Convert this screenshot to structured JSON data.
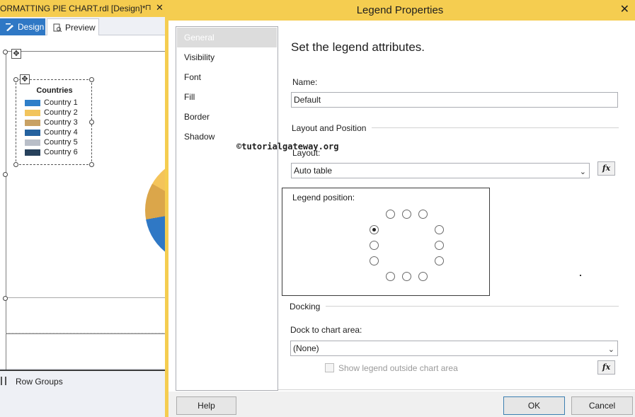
{
  "designer": {
    "doc_tab_title": "ORMATTING PIE CHART.rdl [Design]*",
    "doc_tab_pin": "⊓",
    "doc_tab_close": "✕",
    "tabs": [
      {
        "label": "Design"
      },
      {
        "label": "Preview"
      }
    ],
    "legend": {
      "title": "Countries",
      "items": [
        {
          "label": "Country 1",
          "color": "#2f7fc9"
        },
        {
          "label": "Country 2",
          "color": "#f2c45c"
        },
        {
          "label": "Country 3",
          "color": "#c8a164"
        },
        {
          "label": "Country 4",
          "color": "#25629f"
        },
        {
          "label": "Country 5",
          "color": "#b9bec8"
        },
        {
          "label": "Country 6",
          "color": "#27415c"
        }
      ]
    },
    "row_groups_label": "Row Groups"
  },
  "dialog": {
    "title": "Legend Properties",
    "close_glyph": "✕",
    "nav": [
      {
        "label": "General",
        "selected": true
      },
      {
        "label": "Visibility",
        "selected": false
      },
      {
        "label": "Font",
        "selected": false
      },
      {
        "label": "Fill",
        "selected": false
      },
      {
        "label": "Border",
        "selected": false
      },
      {
        "label": "Shadow",
        "selected": false
      }
    ],
    "heading": "Set the legend attributes.",
    "name_label": "Name:",
    "name_value": "Default",
    "layout_section": "Layout and Position",
    "watermark": "©tutorialgateway.org",
    "layout_label": "Layout:",
    "layout_value": "Auto table",
    "fx_label": "fx",
    "position_label": "Legend position:",
    "selected_position": "left-top",
    "docking_section": "Docking",
    "dock_label": "Dock to chart area:",
    "dock_value": "(None)",
    "show_outside_label": "Show legend outside chart area",
    "show_outside_checked": false,
    "buttons": {
      "help": "Help",
      "ok": "OK",
      "cancel": "Cancel"
    }
  }
}
